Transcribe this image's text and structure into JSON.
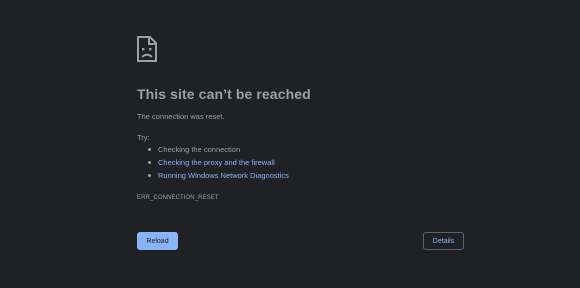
{
  "error_page": {
    "icon": "sad-page-icon",
    "title": "This site can’t be reached",
    "subtitle": "The connection was reset.",
    "try_label": "Try:",
    "suggestions": [
      {
        "text": "Checking the connection"
      },
      {
        "text": "Checking the proxy and the firewall"
      },
      {
        "text": "Running Windows Network Diagnostics"
      }
    ],
    "error_code": "ERR_CONNECTION_RESET",
    "reload_label": "Reload",
    "details_label": "Details"
  },
  "colors": {
    "background": "#202124",
    "text": "#9aa0a6",
    "link": "#8ab4f8",
    "button_border": "#5f6368"
  }
}
